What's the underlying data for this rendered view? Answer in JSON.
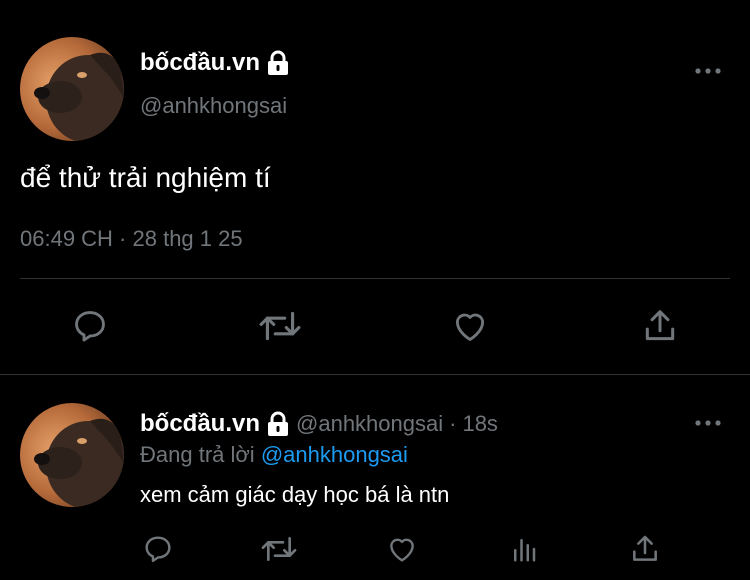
{
  "main_tweet": {
    "display_name": "bốcđầu.vn",
    "handle": "@anhkhongsai",
    "text": "để thử trải nghiệm tí",
    "timestamp": "06:49 CH · 28 thg 1 25",
    "icons": {
      "lock": "lock-icon",
      "more": "more-icon",
      "reply": "reply-icon",
      "retweet": "retweet-icon",
      "like": "heart-icon",
      "share": "share-icon"
    }
  },
  "reply_tweet": {
    "display_name": "bốcđầu.vn",
    "handle": "@anhkhongsai",
    "age": "18s",
    "separator": "·",
    "replying_prefix": "Đang trả lời",
    "replying_to": "@anhkhongsai",
    "text": "xem cảm giác dạy học bá là ntn",
    "icons": {
      "lock": "lock-icon",
      "more": "more-icon",
      "reply": "reply-icon",
      "retweet": "retweet-icon",
      "like": "heart-icon",
      "views": "views-icon",
      "share": "share-icon"
    }
  },
  "colors": {
    "background": "#000000",
    "primary_text": "#ffffff",
    "secondary_text": "#71767b",
    "link": "#1d9bf0",
    "divider": "#2f3336"
  }
}
